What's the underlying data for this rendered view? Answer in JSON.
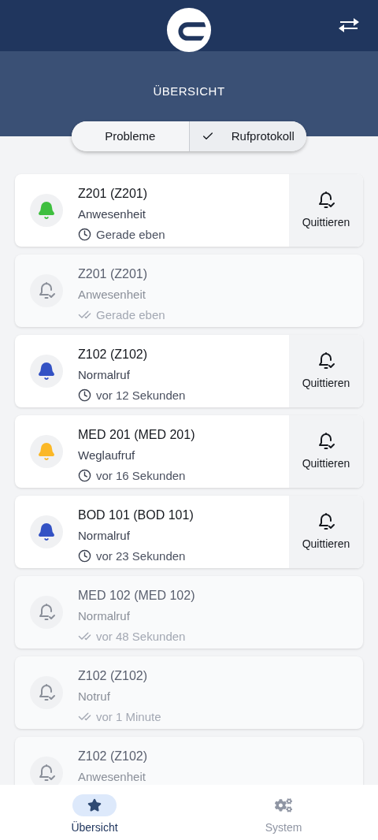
{
  "header": {
    "title": "ÜBERSICHT"
  },
  "tabs": [
    {
      "label": "Probleme",
      "selected": false
    },
    {
      "label": "Rufprotokoll",
      "selected": true
    }
  ],
  "calls": [
    {
      "title": "Z201 (Z201)",
      "type": "Anwesenheit",
      "time": "Gerade eben",
      "acknowledged": false,
      "color": "#3fbf3f",
      "action": "Quittieren"
    },
    {
      "title": "Z201 (Z201)",
      "type": "Anwesenheit",
      "time": "Gerade eben",
      "acknowledged": true
    },
    {
      "title": "Z102 (Z102)",
      "type": "Normalruf",
      "time": "vor 12 Sekunden",
      "acknowledged": false,
      "color": "#3352c4",
      "action": "Quittieren"
    },
    {
      "title": "MED 201 (MED 201)",
      "type": "Weglaufruf",
      "time": "vor 16 Sekunden",
      "acknowledged": false,
      "color": "#fbb827",
      "action": "Quittieren"
    },
    {
      "title": "BOD 101 (BOD 101)",
      "type": "Normalruf",
      "time": "vor 23 Sekunden",
      "acknowledged": false,
      "color": "#3352c4",
      "action": "Quittieren"
    },
    {
      "title": "MED 102 (MED 102)",
      "type": "Normalruf",
      "time": "vor 48 Sekunden",
      "acknowledged": true
    },
    {
      "title": "Z102 (Z102)",
      "type": "Notruf",
      "time": "vor 1 Minute",
      "acknowledged": true
    },
    {
      "title": "Z102 (Z102)",
      "type": "Anwesenheit",
      "acknowledged": true
    }
  ],
  "bottom_nav": [
    {
      "label": "Übersicht",
      "kind": "star",
      "selected": true
    },
    {
      "label": "System",
      "kind": "gears",
      "selected": false
    }
  ]
}
